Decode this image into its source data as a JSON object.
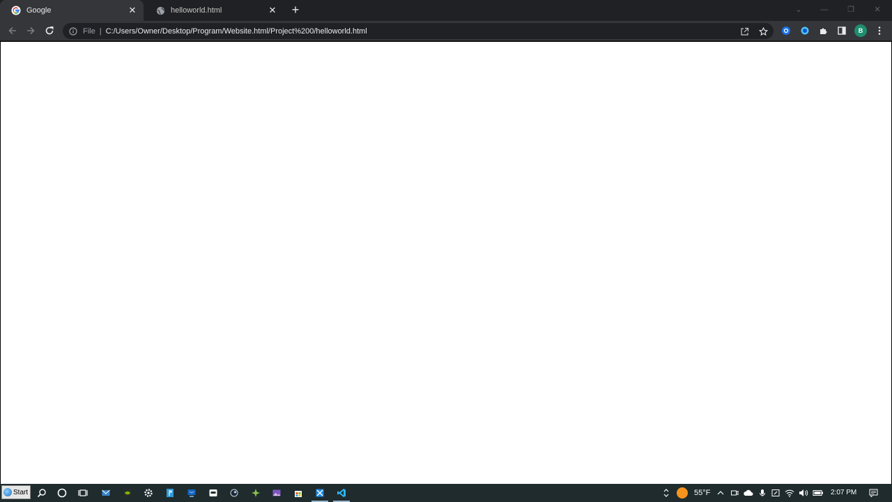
{
  "browser": {
    "tabs": [
      {
        "title": "Google",
        "favicon": "google-g-icon",
        "active": true
      },
      {
        "title": "helloworld.html",
        "favicon": "globe-icon",
        "active": false
      }
    ],
    "omnibox": {
      "scheme_label": "File",
      "separator": "|",
      "url": "C:/Users/Owner/Desktop/Program/Website.html/Project%200/helloworld.html"
    },
    "profile_initial": "B"
  },
  "taskbar": {
    "start_label": "Start",
    "weather_temp": "55°F",
    "clock": "2:07 PM"
  },
  "colors": {
    "tabstrip_bg": "#202124",
    "toolbar_bg": "#35363a",
    "omnibox_bg": "#202124",
    "page_bg": "#ffffff",
    "taskbar_bg": "#1f2b2d",
    "avatar_bg": "#1e8e6e"
  }
}
